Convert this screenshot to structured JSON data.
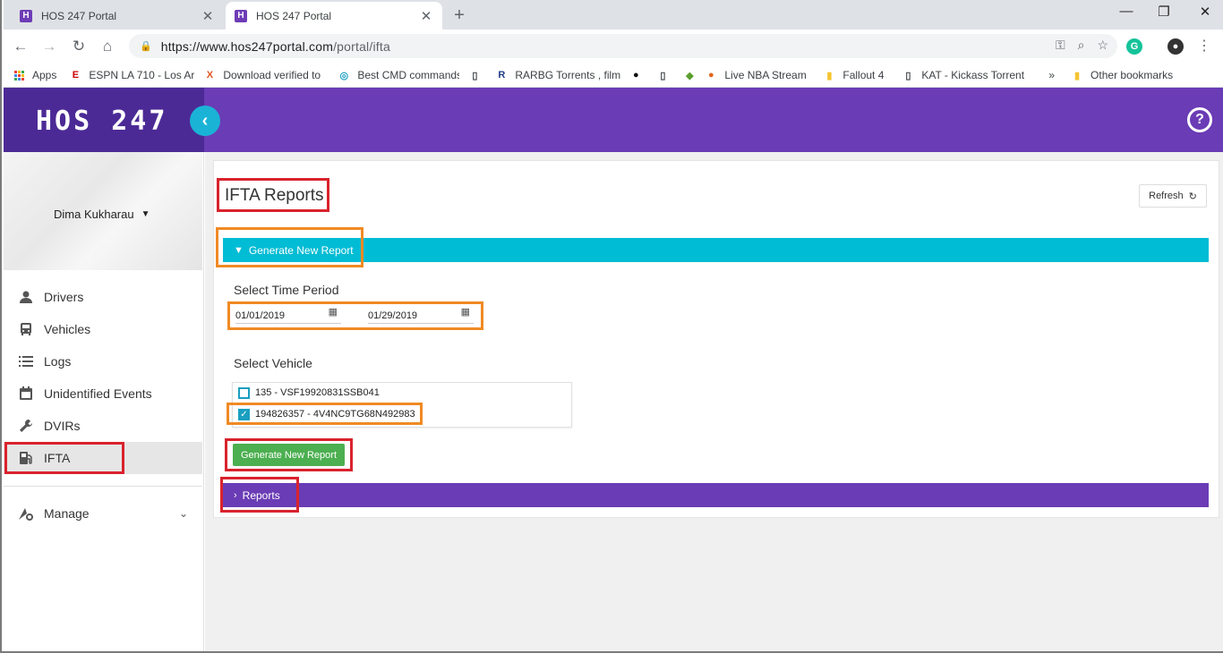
{
  "browser": {
    "tabs": [
      {
        "title": "HOS 247 Portal",
        "favicon": "H",
        "active": false
      },
      {
        "title": "HOS 247 Portal",
        "favicon": "H",
        "active": true
      }
    ],
    "url_host": "https://www.hos247portal.com",
    "url_path": "/portal/ifta",
    "bookmarks": [
      {
        "label": "Apps",
        "icon": "apps-grid-icon"
      },
      {
        "label": "ESPN LA 710 - Los Ar",
        "icon": "espn-icon"
      },
      {
        "label": "Download verified to",
        "icon": "x-icon"
      },
      {
        "label": "Best CMD commands",
        "icon": "globe-icon"
      },
      {
        "label": "",
        "icon": "page-icon"
      },
      {
        "label": "RARBG Torrents , film",
        "icon": "r-icon"
      },
      {
        "label": "",
        "icon": "spotify-icon"
      },
      {
        "label": "",
        "icon": "page-icon"
      },
      {
        "label": "",
        "icon": "leaf-icon"
      },
      {
        "label": "Live NBA Stream",
        "icon": "basketball-icon"
      },
      {
        "label": "Fallout 4",
        "icon": "folder-icon"
      },
      {
        "label": "KAT - Kickass Torrent",
        "icon": "page-icon"
      }
    ],
    "more_bookmarks": "»",
    "other_bookmarks": "Other bookmarks"
  },
  "app": {
    "brand": "HOS 247",
    "collapse_icon": "‹",
    "help_icon": "?",
    "accent_color": "#6a3cb5",
    "cyan_color": "#00bcd4"
  },
  "sidebar": {
    "user_name": "Dima Kukharau",
    "items": [
      {
        "label": "Drivers",
        "icon": "person-icon"
      },
      {
        "label": "Vehicles",
        "icon": "bus-icon"
      },
      {
        "label": "Logs",
        "icon": "list-icon"
      },
      {
        "label": "Unidentified Events",
        "icon": "calendar-icon"
      },
      {
        "label": "DVIRs",
        "icon": "wrench-icon"
      },
      {
        "label": "IFTA",
        "icon": "fuel-icon",
        "active": true
      }
    ],
    "manage_label": "Manage"
  },
  "main": {
    "title": "IFTA Reports",
    "refresh_label": "Refresh",
    "generate_panel_label": "Generate New Report",
    "time_period_label": "Select Time Period",
    "date_from": "01/01/2019",
    "date_to": "01/29/2019",
    "vehicle_label": "Select Vehicle",
    "vehicles": [
      {
        "label": "135 - VSF19920831SSB041",
        "checked": false
      },
      {
        "label": "194826357 - 4V4NC9TG68N492983",
        "checked": true
      }
    ],
    "generate_button": "Generate New Report",
    "reports_panel_label": "Reports"
  }
}
